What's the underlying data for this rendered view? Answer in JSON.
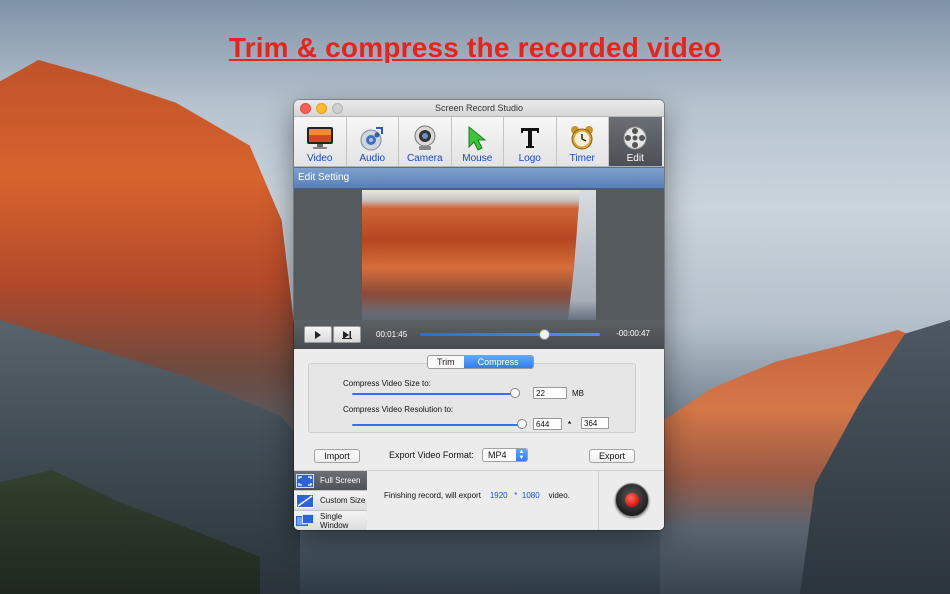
{
  "headline": "Trim &  compress the recorded video",
  "window": {
    "title": "Screen Record Studio"
  },
  "toolbar": {
    "items": [
      {
        "label": "Video",
        "icon": "monitor-icon"
      },
      {
        "label": "Audio",
        "icon": "speaker-icon"
      },
      {
        "label": "Camera",
        "icon": "webcam-icon"
      },
      {
        "label": "Mouse",
        "icon": "cursor-icon"
      },
      {
        "label": "Logo",
        "icon": "text-t-icon"
      },
      {
        "label": "Timer",
        "icon": "alarm-clock-icon"
      },
      {
        "label": "Edit",
        "icon": "film-reel-icon",
        "active": true
      }
    ]
  },
  "section_title": "Edit Setting",
  "playback": {
    "current_time": "00:01:45",
    "remaining_time": "-00:00:47",
    "progress": 0.69
  },
  "tabs": {
    "trim": "Trim",
    "compress": "Compress",
    "selected": "Compress"
  },
  "compress": {
    "size_label": "Compress Video Size to:",
    "size_value": "22",
    "size_unit": "MB",
    "size_slider": 0.97,
    "resolution_label": "Compress Video Resolution to:",
    "res_width": "644",
    "res_separator": "*",
    "res_height": "364",
    "res_slider": 0.99
  },
  "actions": {
    "import": "Import",
    "format_label": "Export Video Format:",
    "format_value": "MP4",
    "export": "Export"
  },
  "modes": [
    {
      "label": "Full Screen",
      "icon": "fullscreen-icon",
      "active": true
    },
    {
      "label": "Custom Size",
      "icon": "custom-size-icon"
    },
    {
      "label": "Single Window",
      "icon": "single-window-icon"
    }
  ],
  "finish": {
    "prefix": "Finishing record, will export",
    "width": "1920",
    "sep": "*",
    "height": "1080",
    "suffix": "video."
  },
  "colors": {
    "headline": "#e8231b",
    "link_blue": "#1a46c8",
    "accent": "#2f80ee",
    "record": "#d6160c"
  }
}
